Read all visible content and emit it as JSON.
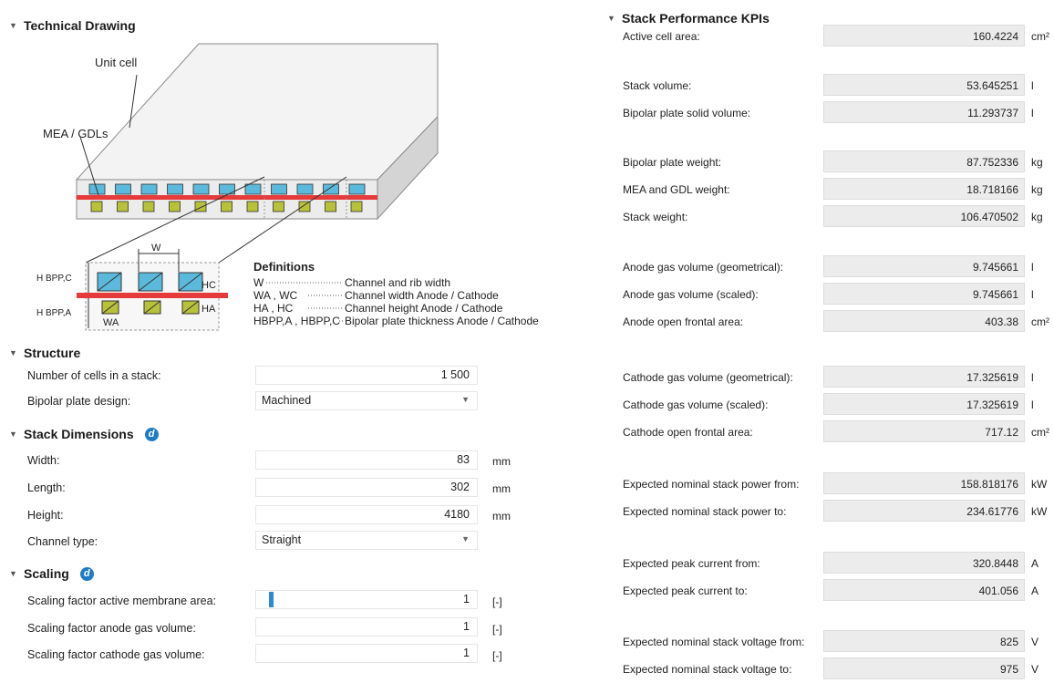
{
  "tech": {
    "title": "Technical Drawing",
    "unit_cell": "Unit cell",
    "mea": "MEA / GDLs",
    "w": "W",
    "hbppc": "H BPP,C",
    "hbppa": "H BPP,A",
    "hc": "HC",
    "ha": "HA",
    "wa": "WA",
    "defs_title": "Definitions",
    "defs": [
      {
        "sym": "W",
        "desc": "Channel and rib width"
      },
      {
        "sym": "WA , WC",
        "desc": "Channel width Anode / Cathode"
      },
      {
        "sym": "HA , HC",
        "desc": "Channel height Anode / Cathode"
      },
      {
        "sym": "HBPP,A , HBPP,C",
        "desc": "Bipolar plate thickness Anode / Cathode"
      }
    ]
  },
  "structure": {
    "title": "Structure",
    "cells_label": "Number of cells in a stack:",
    "cells_value": "1 500",
    "bpp_label": "Bipolar plate design:",
    "bpp_value": "Machined"
  },
  "dims": {
    "title": "Stack Dimensions",
    "width_label": "Width:",
    "width_value": "83",
    "length_label": "Length:",
    "length_value": "302",
    "height_label": "Height:",
    "height_value": "4180",
    "unit": "mm",
    "channel_label": "Channel type:",
    "channel_value": "Straight"
  },
  "scaling": {
    "title": "Scaling",
    "membrane_label": "Scaling factor active membrane area:",
    "membrane_value": "1",
    "anode_label": "Scaling factor anode gas volume:",
    "anode_value": "1",
    "cathode_label": "Scaling factor cathode gas volume:",
    "cathode_value": "1",
    "unit": "[-]",
    "membrane_slider_level": 0.02
  },
  "kpis": {
    "title": "Stack Performance KPIs",
    "rows": [
      {
        "label": "Active cell area:",
        "value": "160.4224",
        "unit": "cm²"
      },
      {
        "label": "Stack volume:",
        "value": "53.645251",
        "unit": "l"
      },
      {
        "label": "Bipolar plate solid volume:",
        "value": "11.293737",
        "unit": "l"
      },
      {
        "label": "Bipolar plate weight:",
        "value": "87.752336",
        "unit": "kg"
      },
      {
        "label": "MEA and GDL weight:",
        "value": "18.718166",
        "unit": "kg"
      },
      {
        "label": "Stack weight:",
        "value": "106.470502",
        "unit": "kg"
      },
      {
        "label": "Anode gas volume (geometrical):",
        "value": "9.745661",
        "unit": "l"
      },
      {
        "label": "Anode gas volume (scaled):",
        "value": "9.745661",
        "unit": "l"
      },
      {
        "label": "Anode open frontal area:",
        "value": "403.38",
        "unit": "cm²"
      },
      {
        "label": "Cathode gas volume (geometrical):",
        "value": "17.325619",
        "unit": "l"
      },
      {
        "label": "Cathode gas volume (scaled):",
        "value": "17.325619",
        "unit": "l"
      },
      {
        "label": "Cathode open frontal area:",
        "value": "717.12",
        "unit": "cm²"
      },
      {
        "label": "Expected nominal stack power from:",
        "value": "158.818176",
        "unit": "kW"
      },
      {
        "label": "Expected nominal stack power to:",
        "value": "234.61776",
        "unit": "kW"
      },
      {
        "label": "Expected peak current from:",
        "value": "320.8448",
        "unit": "A"
      },
      {
        "label": "Expected peak current to:",
        "value": "401.056",
        "unit": "A"
      },
      {
        "label": "Expected nominal stack voltage from:",
        "value": "825",
        "unit": "V"
      },
      {
        "label": "Expected nominal stack voltage to:",
        "value": "975",
        "unit": "V"
      }
    ]
  },
  "colors": {
    "accent": "#1f7bc4",
    "membrane": "#e63b3b",
    "cathode_channel": "#5bb9dc",
    "anode_channel": "#b8c238"
  }
}
